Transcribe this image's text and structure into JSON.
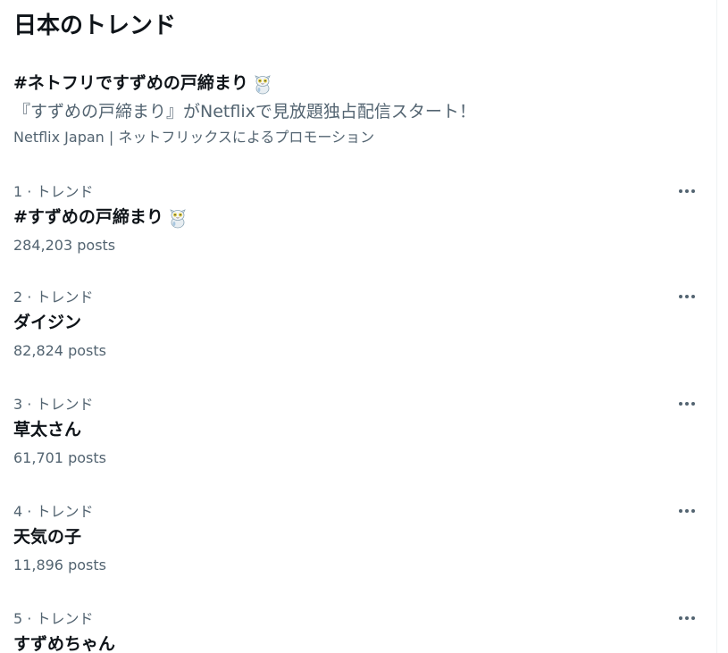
{
  "header": {
    "title": "日本のトレンド"
  },
  "promo": {
    "title": "#ネトフリですずめの戸締まり",
    "description": "『すずめの戸締まり』がNetflixで見放題独占配信スタート！",
    "promoted_by": "Netflix Japan | ネットフリックスによるプロモーション",
    "emoji_icon": "cat-daijin-icon"
  },
  "trends": [
    {
      "meta": "1 · トレンド",
      "name": "#すずめの戸締まり",
      "count": "284,203 posts",
      "emoji_icon": "cat-daijin-icon"
    },
    {
      "meta": "2 · トレンド",
      "name": "ダイジン",
      "count": "82,824 posts"
    },
    {
      "meta": "3 · トレンド",
      "name": "草太さん",
      "count": "61,701 posts"
    },
    {
      "meta": "4 · トレンド",
      "name": "天気の子",
      "count": "11,896 posts"
    },
    {
      "meta": "5 · トレンド",
      "name": "すずめちゃん",
      "count": ""
    }
  ],
  "icons": {
    "more": "more-options-icon"
  },
  "colors": {
    "primary_text": "#0f1419",
    "secondary_text": "#536471",
    "divider": "#eff3f4"
  }
}
